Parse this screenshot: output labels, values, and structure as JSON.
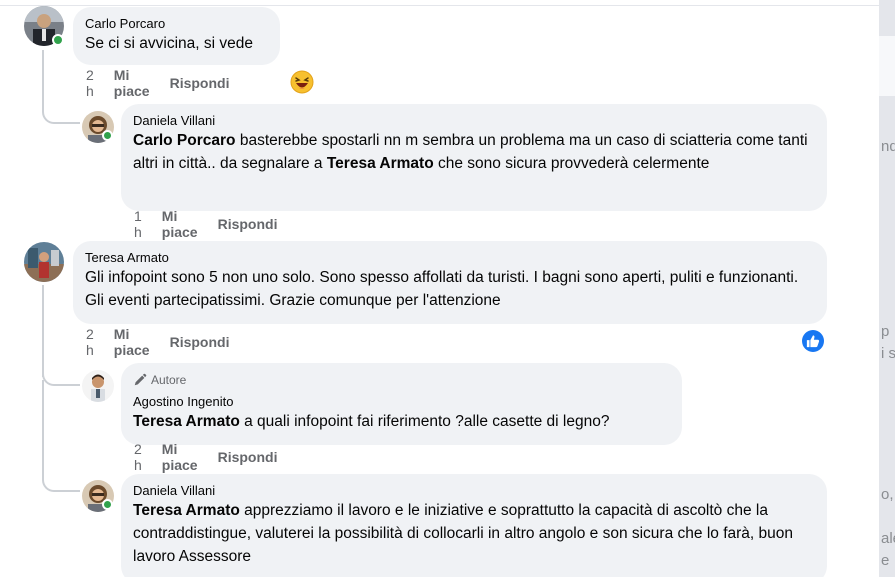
{
  "action_labels": {
    "like": "Mi piace",
    "reply": "Rispondi"
  },
  "comments": [
    {
      "author": "Carlo Porcaro",
      "text": "Se ci si avvicina, si vede",
      "time": "2 h"
    },
    {
      "author": "Daniela Villani",
      "mention1": "Carlo Porcaro",
      "text1": " basterebbe spostarli nn m sembra un problema ma un caso di sciatteria come tanti altri in città.. da segnalare a ",
      "mention2": "Teresa Armato",
      "text2": " che sono sicura provvederà celermente",
      "time": "1 h"
    },
    {
      "author": "Teresa Armato",
      "text": "Gli infopoint sono 5 non uno solo. Sono spesso affollati da turisti. I bagni sono aperti, puliti e funzionanti. Gli eventi partecipatissimi. Grazie comunque per l'attenzione",
      "time": "2 h"
    },
    {
      "badge": "Autore",
      "author": "Agostino Ingenito",
      "mention": "Teresa Armato",
      "text": " a quali infopoint fai riferimento ?alle casette di legno?",
      "time": "2 h"
    },
    {
      "author": "Daniela Villani",
      "mention": "Teresa Armato",
      "text": " apprezziamo il lavoro e le iniziative e soprattutto la capacità di ascoltò che la contraddistingue, valuterei la possibilità di collocarli in altro angolo e son sicura che lo farà, buon lavoro Assessore"
    }
  ],
  "background_fragments": [
    "nd",
    "p",
    "i s",
    "o,",
    "ale",
    "e"
  ],
  "colors": {
    "bubble": "#f0f2f5",
    "secondary_text": "#65676b",
    "online": "#31a24c",
    "like_blue": "#1877f2"
  },
  "icons": {
    "reaction": "laughing-emoji-icon",
    "like": "thumbs-up-icon",
    "author_badge": "pen-icon"
  }
}
